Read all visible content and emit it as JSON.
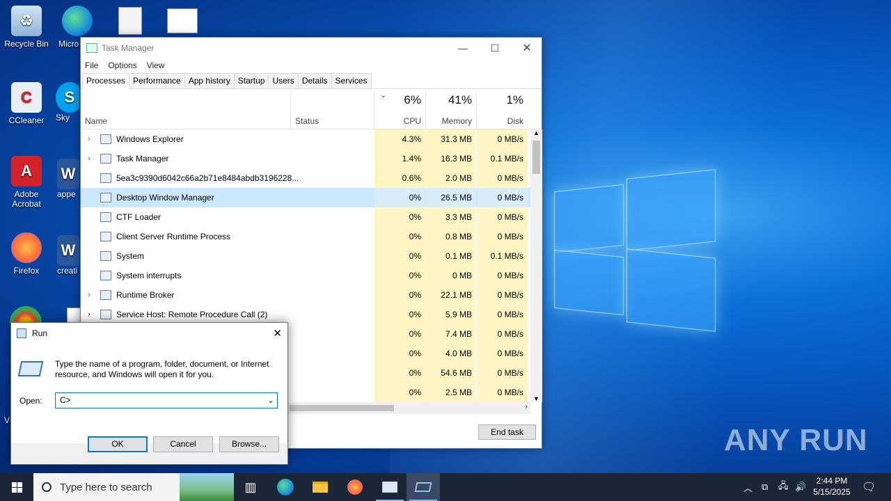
{
  "desktop": {
    "icons": [
      {
        "label": "Recycle Bin"
      },
      {
        "label": "Micro Edg"
      },
      {
        "label": "CCleaner"
      },
      {
        "label": "Sky"
      },
      {
        "label": "Adobe Acrobat"
      },
      {
        "label": "appe"
      },
      {
        "label": "Firefox"
      },
      {
        "label": "creati"
      },
      {
        "label": "V"
      }
    ],
    "watermark": "ANY RUN"
  },
  "task_manager": {
    "title": "Task Manager",
    "menu": [
      "File",
      "Options",
      "View"
    ],
    "tabs": [
      "Processes",
      "Performance",
      "App history",
      "Startup",
      "Users",
      "Details",
      "Services"
    ],
    "active_tab": "Processes",
    "columns": {
      "name": "Name",
      "status": "Status",
      "cpu_pct": "6%",
      "cpu": "CPU",
      "mem_pct": "41%",
      "mem": "Memory",
      "disk_pct": "1%",
      "disk": "Disk"
    },
    "rows": [
      {
        "name": "Windows Explorer",
        "expand": "›",
        "cpu": "4.3%",
        "mem": "31.3 MB",
        "disk": "0 MB/s"
      },
      {
        "name": "Task Manager",
        "expand": "›",
        "cpu": "1.4%",
        "mem": "16.3 MB",
        "disk": "0.1 MB/s"
      },
      {
        "name": "5ea3c9390d6042c66a2b71e8484abdb3196228...",
        "expand": "",
        "cpu": "0.6%",
        "mem": "2.0 MB",
        "disk": "0 MB/s"
      },
      {
        "name": "Desktop Window Manager",
        "expand": "",
        "cpu": "0%",
        "mem": "26.5 MB",
        "disk": "0 MB/s"
      },
      {
        "name": "CTF Loader",
        "expand": "",
        "cpu": "0%",
        "mem": "3.3 MB",
        "disk": "0 MB/s"
      },
      {
        "name": "Client Server Runtime Process",
        "expand": "",
        "cpu": "0%",
        "mem": "0.8 MB",
        "disk": "0 MB/s"
      },
      {
        "name": "System",
        "expand": "",
        "cpu": "0%",
        "mem": "0.1 MB",
        "disk": "0.1 MB/s"
      },
      {
        "name": "System interrupts",
        "expand": "",
        "cpu": "0%",
        "mem": "0 MB",
        "disk": "0 MB/s"
      },
      {
        "name": "Runtime Broker",
        "expand": "›",
        "cpu": "0%",
        "mem": "22.1 MB",
        "disk": "0 MB/s"
      },
      {
        "name": "Service Host: Remote Procedure Call (2)",
        "expand": "›",
        "cpu": "0%",
        "mem": "5.9 MB",
        "disk": "0 MB/s"
      },
      {
        "name": "",
        "expand": "",
        "cpu": "0%",
        "mem": "7.4 MB",
        "disk": "0 MB/s"
      },
      {
        "name": "",
        "expand": "",
        "cpu": "0%",
        "mem": "4.0 MB",
        "disk": "0 MB/s"
      },
      {
        "name": "",
        "expand": "",
        "cpu": "0%",
        "mem": "54.6 MB",
        "disk": "0 MB/s"
      },
      {
        "name": "",
        "expand": "",
        "cpu": "0%",
        "mem": "2.5 MB",
        "disk": "0 MB/s"
      }
    ],
    "selected_row": "Desktop Window Manager",
    "end_task": "End task"
  },
  "run_dialog": {
    "title": "Run",
    "description": "Type the name of a program, folder, document, or Internet resource, and Windows will open it for you.",
    "open_label": "Open:",
    "open_value": "C>",
    "ok": "OK",
    "cancel": "Cancel",
    "browse": "Browse..."
  },
  "taskbar": {
    "search_placeholder": "Type here to search",
    "time": "2:44 PM",
    "date": "5/15/2025"
  },
  "colors": {
    "accent": "#0078d7",
    "selection": "#cce8ff",
    "heat": "#fff4c4",
    "taskbar": "#1c2636"
  }
}
